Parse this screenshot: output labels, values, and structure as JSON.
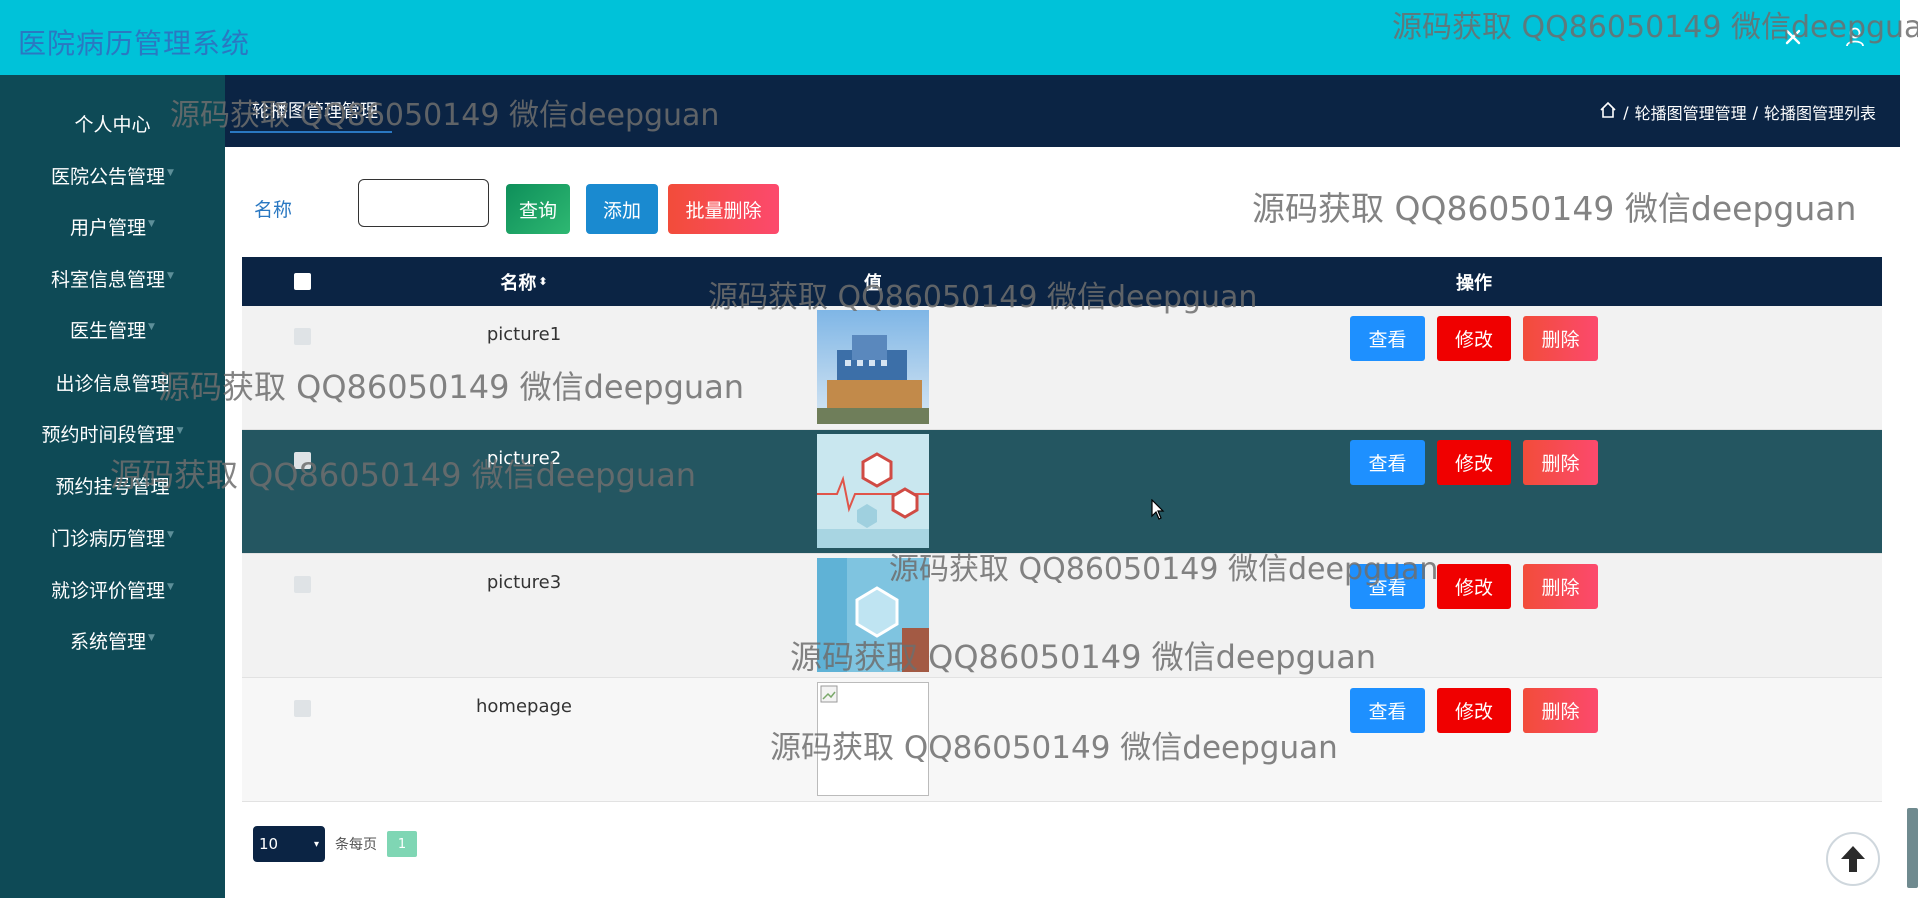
{
  "app": {
    "title": "医院病历管理系统"
  },
  "topbar_icons": [
    "close-icon",
    "user-icon"
  ],
  "sidebar": {
    "items": [
      {
        "label": "个人中心",
        "has_caret": false
      },
      {
        "label": "医院公告管理",
        "has_caret": true
      },
      {
        "label": "用户管理",
        "has_caret": true
      },
      {
        "label": "科室信息管理",
        "has_caret": true
      },
      {
        "label": "医生管理",
        "has_caret": true
      },
      {
        "label": "出诊信息管理",
        "has_caret": false
      },
      {
        "label": "预约时间段管理",
        "has_caret": true
      },
      {
        "label": "预约挂号管理",
        "has_caret": false
      },
      {
        "label": "门诊病历管理",
        "has_caret": true
      },
      {
        "label": "就诊评价管理",
        "has_caret": true
      },
      {
        "label": "系统管理",
        "has_caret": true
      }
    ]
  },
  "subheader": {
    "tab": "轮播图管理管理",
    "breadcrumb": [
      "轮播图管理管理",
      "轮播图管理列表"
    ],
    "separator": "/"
  },
  "search": {
    "label": "名称",
    "value": "",
    "query_button": "查询",
    "add_button": "添加",
    "batch_delete_button": "批量删除"
  },
  "table": {
    "headers": {
      "name": "名称",
      "value": "值",
      "actions": "操作"
    },
    "rows": [
      {
        "name": "picture1",
        "image": "hospital-building"
      },
      {
        "name": "picture2",
        "image": "medical-hexagons"
      },
      {
        "name": "picture3",
        "image": "medical-blue"
      },
      {
        "name": "homepage",
        "image": "broken-image"
      }
    ],
    "action_labels": {
      "view": "查看",
      "edit": "修改",
      "delete": "删除"
    }
  },
  "pager": {
    "page_size": "10",
    "per_page_text": "条每页",
    "current_page": "1"
  },
  "watermark_text": "源码获取 QQ86050149 微信deepguan",
  "colors": {
    "topbar": "#00c2d9",
    "sidebar": "#0e4a56",
    "header_dark": "#0b2444",
    "highlight_row": "#245661",
    "view": "#1e90ff",
    "edit": "#f00000",
    "delete": "#f24c3a"
  }
}
